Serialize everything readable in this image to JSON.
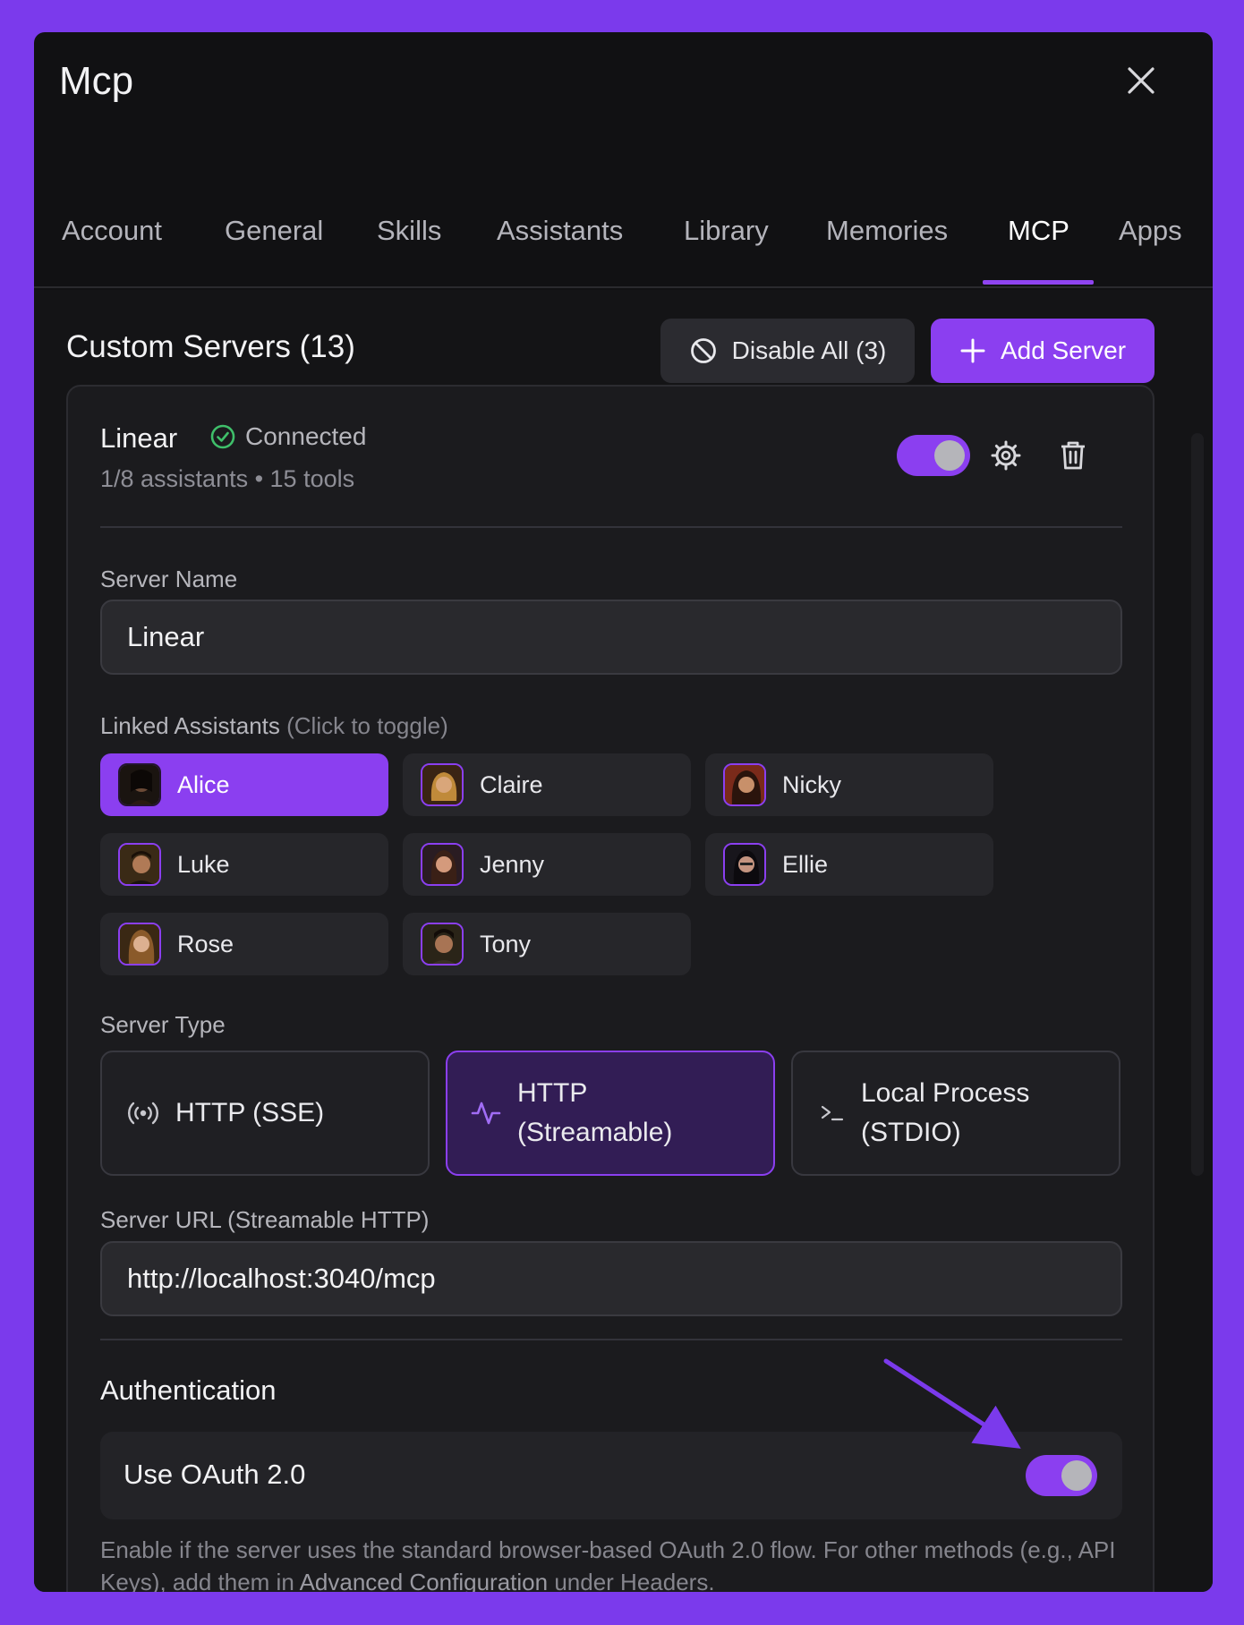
{
  "window": {
    "title": "Mcp"
  },
  "tabs": [
    {
      "label": "Account"
    },
    {
      "label": "General"
    },
    {
      "label": "Skills"
    },
    {
      "label": "Assistants"
    },
    {
      "label": "Library"
    },
    {
      "label": "Memories"
    },
    {
      "label": "MCP",
      "active": true
    },
    {
      "label": "Apps"
    }
  ],
  "header": {
    "title": "Custom Servers (13)",
    "disable_all_label": "Disable All (3)",
    "add_server_label": "Add Server"
  },
  "server": {
    "name": "Linear",
    "status": "Connected",
    "meta": "1/8 assistants • 15 tools",
    "enabled": true
  },
  "form": {
    "name_label": "Server Name",
    "name_value": "Linear",
    "assistants_label": "Linked Assistants",
    "assistants_hint": "(Click to toggle)",
    "assistants": [
      {
        "name": "Alice",
        "selected": true
      },
      {
        "name": "Claire",
        "selected": false
      },
      {
        "name": "Nicky",
        "selected": false
      },
      {
        "name": "Luke",
        "selected": false
      },
      {
        "name": "Jenny",
        "selected": false
      },
      {
        "name": "Ellie",
        "selected": false
      },
      {
        "name": "Rose",
        "selected": false
      },
      {
        "name": "Tony",
        "selected": false
      }
    ],
    "type_label": "Server Type",
    "types": [
      {
        "line1": "HTTP (SSE)",
        "line2": "",
        "icon": "broadcast-icon",
        "selected": false
      },
      {
        "line1": "HTTP",
        "line2": "(Streamable)",
        "icon": "activity-icon",
        "selected": true
      },
      {
        "line1": "Local Process",
        "line2": "(STDIO)",
        "icon": "terminal-icon",
        "selected": false
      }
    ],
    "url_label": "Server URL (Streamable HTTP)",
    "url_value": "http://localhost:3040/mcp",
    "auth_heading": "Authentication",
    "oauth_label": "Use OAuth 2.0",
    "oauth_enabled": true,
    "help_before": "Enable if the server uses the standard browser-based OAuth 2.0 flow. For other methods (e.g., API Keys), add them in ",
    "help_link": "Advanced Configuration",
    "help_after": " under Headers."
  },
  "colors": {
    "background": "#7b3aec",
    "accent": "#8b3ff0",
    "success": "#3fbf6a",
    "window": "#111113"
  }
}
